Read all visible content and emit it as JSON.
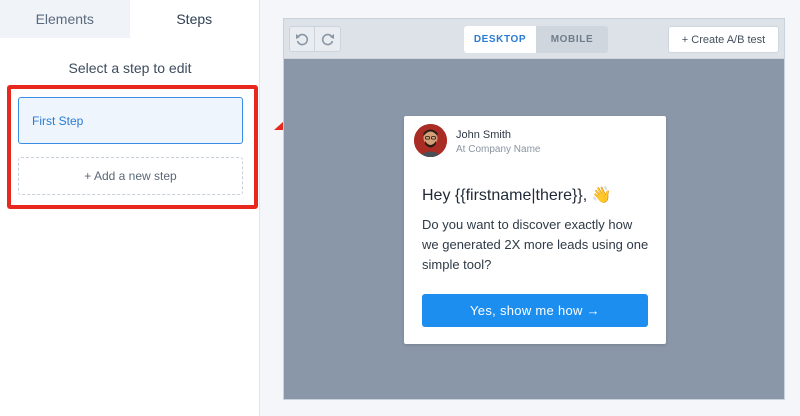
{
  "sidebar": {
    "tabs": [
      {
        "label": "Elements",
        "active": false
      },
      {
        "label": "Steps",
        "active": true
      }
    ],
    "title": "Select a step to edit",
    "steps": [
      {
        "label": "First Step",
        "selected": true
      }
    ],
    "add_step_label": "+ Add a new step"
  },
  "toolbar": {
    "undo_icon": "undo-icon",
    "redo_icon": "redo-icon",
    "device_options": [
      {
        "label": "DESKTOP",
        "active": true
      },
      {
        "label": "MOBILE",
        "active": false
      }
    ],
    "ab_test_label": "+ Create A/B test"
  },
  "card": {
    "sender_name": "John Smith",
    "sender_company": "At Company Name",
    "heading": "Hey {{firstname|there}}, 👋",
    "body": "Do you want to discover exactly how we generated 2X more leads using one simple tool?",
    "cta_label": "Yes, show me how →"
  },
  "colors": {
    "accent": "#1b8ef0",
    "highlight": "#e8281f",
    "preview_bg": "#8a97a8"
  }
}
